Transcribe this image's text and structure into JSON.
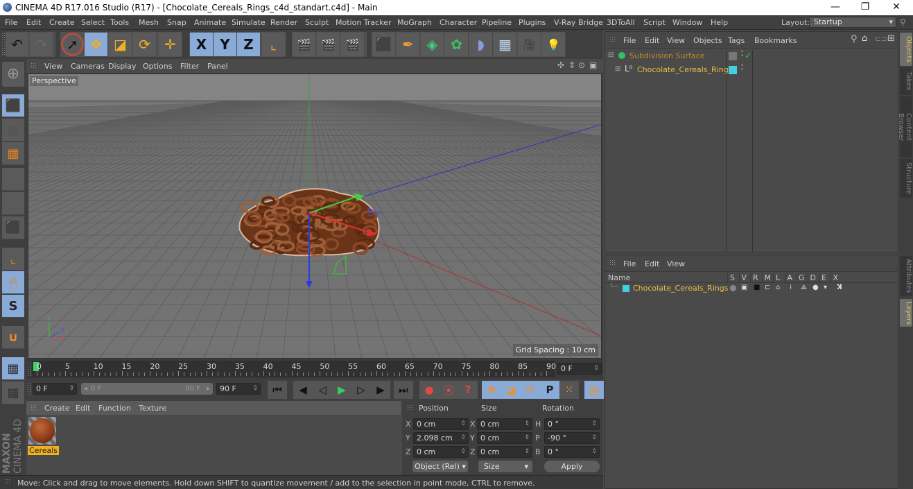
{
  "window": {
    "title": "CINEMA 4D R17.016 Studio (R17) - [Chocolate_Cereals_Rings_c4d_standart.c4d] - Main",
    "controls": [
      "—",
      "❐",
      "✕"
    ]
  },
  "menubar": {
    "items": [
      "File",
      "Edit",
      "Create",
      "Select",
      "Tools",
      "Mesh",
      "Snap",
      "Animate",
      "Simulate",
      "Render",
      "Sculpt",
      "Motion Tracker",
      "MoGraph",
      "Character",
      "Pipeline",
      "Plugins",
      "V-Ray Bridge",
      "3DToAll",
      "Script",
      "Window",
      "Help"
    ],
    "layout_label": "Layout:",
    "layout_value": "Startup"
  },
  "toolbar": {
    "buttons": [
      {
        "name": "undo",
        "icon": "↶"
      },
      {
        "name": "redo",
        "icon": "↷"
      },
      {
        "name": "live-selection",
        "icon": "➚"
      },
      {
        "name": "move",
        "icon": "✥"
      },
      {
        "name": "scale",
        "icon": "◪"
      },
      {
        "name": "rotate",
        "icon": "⟳"
      },
      {
        "name": "recent-tool",
        "icon": "✛"
      },
      {
        "name": "x-axis",
        "icon": "X"
      },
      {
        "name": "y-axis",
        "icon": "Y"
      },
      {
        "name": "z-axis",
        "icon": "Z"
      },
      {
        "name": "coordinate-system",
        "icon": "⌞"
      },
      {
        "name": "render-view",
        "icon": "🎬"
      },
      {
        "name": "render-to-picture-viewer",
        "icon": "🎬"
      },
      {
        "name": "render-settings",
        "icon": "🎬"
      },
      {
        "name": "cube",
        "icon": "⬛"
      },
      {
        "name": "pen-spline",
        "icon": "✒"
      },
      {
        "name": "subdivision-surface",
        "icon": "◈"
      },
      {
        "name": "cloner",
        "icon": "✿"
      },
      {
        "name": "bend-deformer",
        "icon": "◗"
      },
      {
        "name": "floor",
        "icon": "▦"
      },
      {
        "name": "camera",
        "icon": "🎥"
      },
      {
        "name": "light",
        "icon": "💡"
      }
    ]
  },
  "viewport": {
    "menu": [
      "View",
      "Cameras",
      "Display",
      "Options",
      "Filter",
      "Panel"
    ],
    "label": "Perspective",
    "grid_spacing": "Grid Spacing : 10 cm",
    "axis_labels": {
      "y": "Y",
      "z": "Z",
      "x": "X"
    }
  },
  "left_tools": [
    {
      "name": "model-mode",
      "icon": "⬛",
      "active": true
    },
    {
      "name": "texture-mode",
      "icon": "▩",
      "active": false
    },
    {
      "name": "workplane-mode",
      "icon": "▦",
      "active": false
    },
    {
      "name": "points-mode",
      "icon": "⬚",
      "active": false
    },
    {
      "name": "edges-mode",
      "icon": "⬚",
      "active": false
    },
    {
      "name": "polygons-mode",
      "icon": "⬛",
      "active": false
    },
    {
      "name": "axis-mode",
      "icon": "⌞",
      "active": false
    },
    {
      "name": "tweak-mode",
      "icon": "🖱",
      "active": true
    },
    {
      "name": "solo-mode",
      "icon": "S",
      "active": true
    },
    {
      "name": "snap",
      "icon": "∪",
      "active": false
    },
    {
      "name": "workplane-lock",
      "icon": "▦",
      "active": true
    },
    {
      "name": "workplane-align",
      "icon": "▦",
      "active": false
    }
  ],
  "timeline": {
    "ticks": [
      "0",
      "5",
      "10",
      "15",
      "20",
      "25",
      "30",
      "35",
      "40",
      "45",
      "50",
      "55",
      "60",
      "65",
      "70",
      "75",
      "80",
      "85",
      "90"
    ],
    "current_frame": "0 F",
    "start_field": "0 F",
    "range_start": "0 F",
    "range_end": "90 F",
    "end_field": "90 F"
  },
  "transport": {
    "buttons": [
      {
        "name": "go-to-start",
        "icon": "⏮"
      },
      {
        "name": "previous-key",
        "icon": "◀"
      },
      {
        "name": "previous-frame",
        "icon": "◁"
      },
      {
        "name": "play",
        "icon": "▶"
      },
      {
        "name": "next-frame",
        "icon": "▷"
      },
      {
        "name": "next-key",
        "icon": "▶"
      },
      {
        "name": "go-to-end",
        "icon": "⏭"
      },
      {
        "name": "record-keys",
        "icon": "●"
      },
      {
        "name": "autokeying",
        "icon": "⦿"
      },
      {
        "name": "keyframe-selection",
        "icon": "?"
      },
      {
        "name": "key-position",
        "icon": "✥"
      },
      {
        "name": "key-scale",
        "icon": "◪"
      },
      {
        "name": "key-rotation",
        "icon": "⟳"
      },
      {
        "name": "key-parameter",
        "icon": "P"
      },
      {
        "name": "key-pla",
        "icon": "⁙"
      },
      {
        "name": "timeline-window",
        "icon": "▤"
      }
    ]
  },
  "material_manager": {
    "menu": [
      "Create",
      "Edit",
      "Function",
      "Texture"
    ],
    "materials": [
      {
        "name": "Cereals"
      }
    ]
  },
  "brand": {
    "maxon": "MAXON",
    "cinema": "CINEMA 4D"
  },
  "coordinates": {
    "headers": [
      "Position",
      "Size",
      "Rotation"
    ],
    "rows": [
      {
        "pos_axis": "X",
        "pos": "0 cm",
        "size_axis": "X",
        "size": "0 cm",
        "rot_axis": "H",
        "rot": "0 °"
      },
      {
        "pos_axis": "Y",
        "pos": "2.098 cm",
        "size_axis": "Y",
        "size": "0 cm",
        "rot_axis": "P",
        "rot": "-90 °"
      },
      {
        "pos_axis": "Z",
        "pos": "0 cm",
        "size_axis": "Z",
        "size": "0 cm",
        "rot_axis": "B",
        "rot": "0 °"
      }
    ],
    "mode_select": "Object (Rel)",
    "size_select": "Size",
    "apply_label": "Apply"
  },
  "status": {
    "text": "Move: Click and drag to move elements. Hold down SHIFT to quantize movement / add to the selection in point mode, CTRL to remove."
  },
  "object_manager": {
    "menu": [
      "File",
      "Edit",
      "View",
      "Objects",
      "Tags",
      "Bookmarks"
    ],
    "objects": [
      {
        "name": "Subdivision Surface",
        "color": "#c88a2a",
        "icon": "subdivision-icon"
      },
      {
        "name": "Chocolate_Cereals_Rings",
        "color": "#e8c040",
        "icon": "null-object-icon"
      }
    ]
  },
  "layer_manager": {
    "menu": [
      "File",
      "Edit",
      "View"
    ],
    "columns": [
      "Name",
      "S",
      "V",
      "R",
      "M",
      "L",
      "A",
      "G",
      "D",
      "E",
      "X"
    ],
    "layers": [
      {
        "name": "Chocolate_Cereals_Rings",
        "color": "#40d0e0"
      }
    ]
  },
  "side_tabs": {
    "top": [
      {
        "label": "Objects",
        "active": true
      },
      {
        "label": "Takes",
        "active": false
      },
      {
        "label": "Content Browser",
        "active": false
      },
      {
        "label": "Structure",
        "active": false
      }
    ],
    "bottom": [
      {
        "label": "Attributes",
        "active": false
      },
      {
        "label": "Layers",
        "active": true
      }
    ]
  },
  "colors": {
    "accent_selected": "#8aaad8",
    "object_name": "#e8c040",
    "layer_swatch": "#40d0e0",
    "playhead": "#46d46a"
  }
}
